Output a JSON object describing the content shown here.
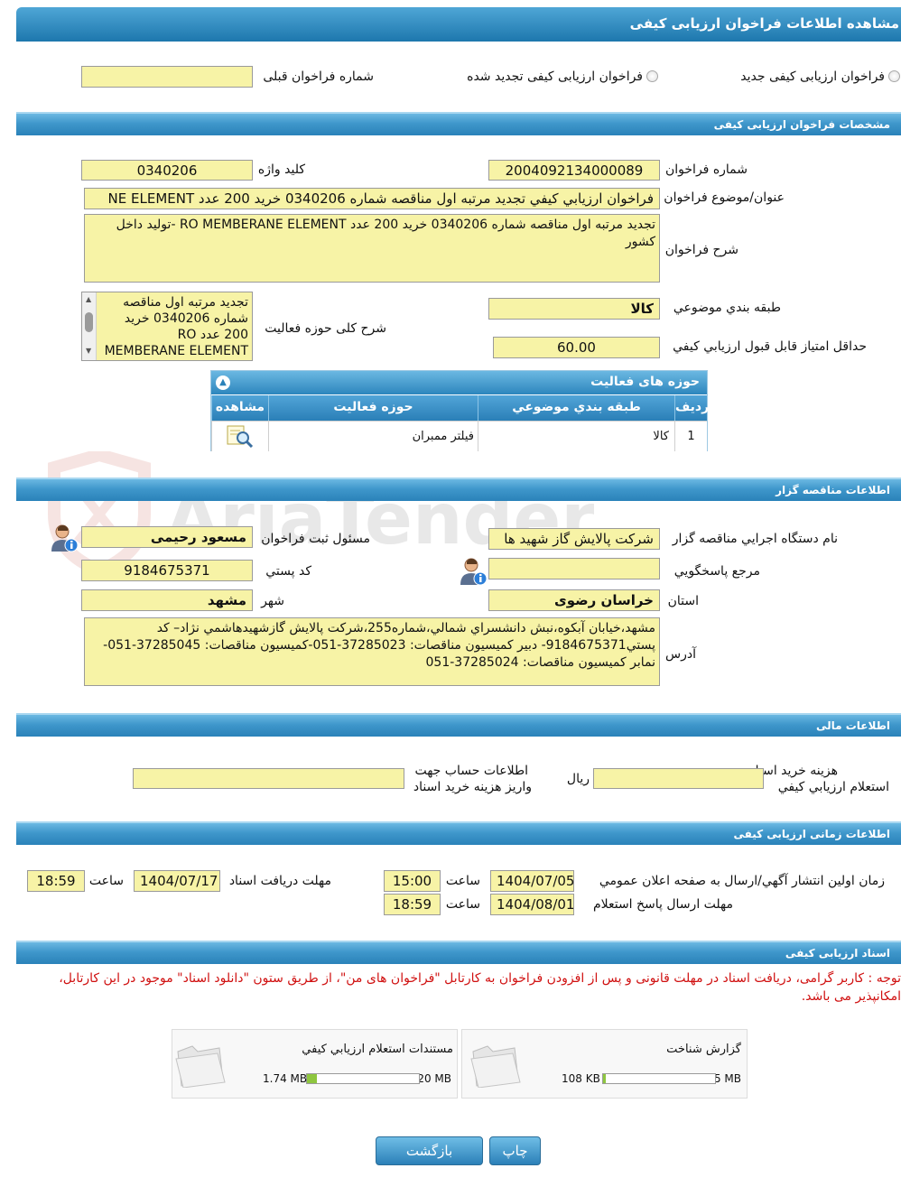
{
  "page_title": "مشاهده اطلاعات فراخوان ارزيابی کيفی",
  "watermark_text": "AriaTender.neT",
  "radios": {
    "new_label": "فراخوان ارزيابی کيفی جديد",
    "renewed_label": "فراخوان ارزيابی کيفی تجديد شده",
    "prev_number_label": "شماره فراخوان قبلی",
    "prev_number_value": ""
  },
  "sections": {
    "specs": "مشخصات فراخوان ارزيابی کيفی",
    "organizer": "اطلاعات مناقصه گزار",
    "financial": "اطلاعات مالی",
    "timing": "اطلاعات زمانی ارزيابی کيفی",
    "documents": "اسناد ارزيابی کيفی"
  },
  "specs": {
    "number_label": "شماره فراخوان",
    "number_value": "2004092134000089",
    "keyword_label": "کليد واژه",
    "keyword_value": "0340206",
    "subject_label": "عنوان/موضوع فراخوان",
    "subject_value": "فراخوان ارزيابي كيفي تجديد مرتبه اول مناقصه شماره 0340206 خريد 200 عدد NE ELEMENT",
    "description_label": "شرح فراخوان",
    "description_value": "تجديد مرتبه اول مناقصه شماره 0340206 خريد 200 عدد RO MEMBERANE ELEMENT -توليد داخل كشور",
    "category_label": "طبقه بندي موضوعي",
    "category_value": "كالا",
    "activity_desc_label": "شرح کلی حوزه فعاليت",
    "activity_desc_value": "تجديد مرتبه اول مناقصه شماره 0340206 خريد 200 عدد RO MEMBERANE ELEMENT -توليد داخل",
    "min_score_label": "حداقل امتياز قابل قبول ارزيابي کيفي",
    "min_score_value": "60.00"
  },
  "activity_grid": {
    "title": "حوزه های فعاليت",
    "columns": [
      "رديف",
      "طبقه بندي موضوعي",
      "حوزه فعاليت",
      "مشاهده"
    ],
    "rows": [
      {
        "index": "1",
        "category": "كالا",
        "activity": "فيلتر ممبران"
      }
    ]
  },
  "organizer": {
    "org_label": "نام دستگاه اجرايي مناقصه گزار",
    "org_value": "شرکت پالايش گاز شهيد ها",
    "responsible_label": "مسئول ثبت فراخوان",
    "responsible_value": "مسعود رحيمی",
    "reference_label": "مرجع پاسخگويي",
    "reference_value": "",
    "postal_label": "کد پستي",
    "postal_value": "9184675371",
    "province_label": "استان",
    "province_value": "خراسان رضوی",
    "city_label": "شهر",
    "city_value": "مشهد",
    "address_label": "آدرس",
    "address_value": "مشهد،خيابان آبكوه،نبش دانشسراي شمالي،شماره255،شركت پالايش گازشهيدهاشمي نژاد– كد پستي9184675371- دبير كميسيون مناقصات: 37285023-051-كميسيون مناقصات: 37285045-051-نمابر كميسيون مناقصات: 37285024-051"
  },
  "financial": {
    "cost_label_1": "هزينه خريد اسناد",
    "cost_label_2": "استعلام ارزيابي کيفي",
    "cost_value": "",
    "currency": "ريال",
    "account_label_1": "اطلاعات حساب جهت",
    "account_label_2": "واريز هزينه خريد اسناد",
    "account_value": ""
  },
  "timing": {
    "publish_label": "زمان اولين انتشار آگهي/ارسال به صفحه اعلان عمومي",
    "publish_date": "1404/07/05",
    "publish_time": "15:00",
    "receive_label": "مهلت دريافت اسناد",
    "receive_date": "1404/07/17",
    "receive_time": "18:59",
    "reply_label": "مهلت ارسال پاسخ استعلام",
    "reply_date": "1404/08/01",
    "reply_time": "18:59",
    "time_label": "ساعت"
  },
  "documents": {
    "note": "توجه : کاربر گرامی، دریافت اسناد در مهلت قانونی و پس از افزودن فراخوان به کارتابل \"فراخوان های من\"، از طریق ستون \"دانلود اسناد\" موجود در این کارتابل، امکانپذیر می باشد.",
    "items": [
      {
        "title": "گزارش شناخت",
        "size": "108 KB",
        "max": "5 MB",
        "fill": 0.021
      },
      {
        "title": "مستندات استعلام ارزيابي کيفي",
        "size": "1.74 MB",
        "max": "20 MB",
        "fill": 0.087
      }
    ]
  },
  "buttons": {
    "print": "چاپ",
    "back": "بازگشت"
  }
}
